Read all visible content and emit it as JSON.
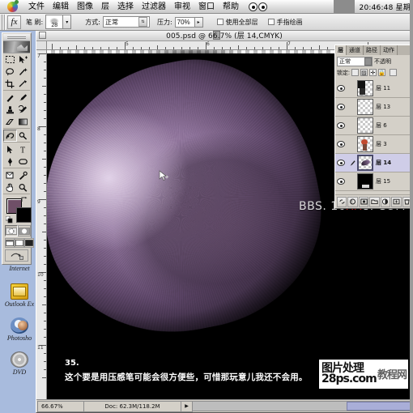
{
  "app": {
    "name": "Adobe Photoshop"
  },
  "menubar": {
    "apple_icon": "apple-logo",
    "items": [
      "文件",
      "编辑",
      "图像",
      "层",
      "选择",
      "过滤器",
      "审视",
      "窗口",
      "帮助"
    ],
    "clock": "20:46:48 星期"
  },
  "options_bar": {
    "tool_icon": "smudge-tool-icon",
    "brush_label": "笔 刷:",
    "brush_size": "28",
    "brush_dropdown_icon": "chevron-down-icon",
    "mode_label": "方式:",
    "mode_value": "正常",
    "mode_dropdown_icon": "updown-spinner-icon",
    "pressure_label": "压力:",
    "pressure_value": "70%",
    "pressure_dropdown_icon": "chevron-down-icon",
    "check_all_layers": "使用全部层",
    "check_finger_paint": "手指绘画"
  },
  "toolbox": {
    "tools": [
      {
        "name": "marquee-tool",
        "glyph": "▭"
      },
      {
        "name": "move-tool",
        "glyph": "✥"
      },
      {
        "name": "lasso-tool",
        "glyph": "◠"
      },
      {
        "name": "magic-wand-tool",
        "glyph": "✦"
      },
      {
        "name": "crop-tool",
        "glyph": "⌗"
      },
      {
        "name": "slice-tool",
        "glyph": "✂"
      },
      {
        "name": "healing-brush-tool",
        "glyph": "✒"
      },
      {
        "name": "paintbrush-tool",
        "glyph": "🖌"
      },
      {
        "name": "clone-stamp-tool",
        "glyph": "❏"
      },
      {
        "name": "history-brush-tool",
        "glyph": "↺"
      },
      {
        "name": "eraser-tool",
        "glyph": "◫"
      },
      {
        "name": "gradient-tool",
        "glyph": "▰"
      },
      {
        "name": "blur-smudge-tool",
        "glyph": "☁"
      },
      {
        "name": "dodge-burn-tool",
        "glyph": "✋"
      },
      {
        "name": "path-selection-tool",
        "glyph": "➤"
      },
      {
        "name": "type-tool",
        "glyph": "T"
      },
      {
        "name": "pen-tool",
        "glyph": "✎"
      },
      {
        "name": "shape-tool",
        "glyph": "▢"
      },
      {
        "name": "notes-tool",
        "glyph": "▤"
      },
      {
        "name": "eyedropper-tool",
        "glyph": "⚲"
      },
      {
        "name": "hand-tool",
        "glyph": "✋"
      },
      {
        "name": "zoom-tool",
        "glyph": "🔍"
      }
    ],
    "selected_tool": "blur-smudge-tool",
    "foreground_color": "#6f4f67",
    "background_color": "#000000",
    "mask_modes": [
      "standard-mask-mode",
      "quick-mask-mode"
    ],
    "screen_modes": [
      "standard-screen-mode",
      "full-screen-with-menubar",
      "full-screen-mode"
    ],
    "jump_to": "jump-to-imageready"
  },
  "document": {
    "title": "005.psd @ 66.7% (层 14,CMYK)",
    "close_icon": "close-box-icon",
    "ruler_h_numbers": [
      "5",
      "6",
      "7"
    ],
    "ruler_v_numbers": [
      "7",
      "8",
      "9",
      "10",
      "11"
    ],
    "canvas_watermark": {
      "line1": "PS",
      "line2_pre": "BBS. 16",
      "line2_red": "XX",
      "line2_post": "8. COM"
    },
    "cursor_icon": "brush-cursor-icon"
  },
  "caption": {
    "number": "35.",
    "text": "这个要是用压感笔可能会很方便些，可惜那玩意儿我还不会用。"
  },
  "watermark_box": {
    "line1": "图片处理",
    "line2": "28ps.com",
    "diagonal": "教程网"
  },
  "status_bar": {
    "zoom": "66.67%",
    "doc_info": "Doc: 62.3M/118.2M",
    "menu_icon": "triangle-right-icon"
  },
  "layers_palette": {
    "tabs": [
      {
        "label": "层",
        "active": true
      },
      {
        "label": "通道",
        "active": false
      },
      {
        "label": "路径",
        "active": false
      },
      {
        "label": "动作",
        "active": false
      }
    ],
    "blend_mode": "正常",
    "opacity_label": "不透明",
    "lock_label": "锁定:",
    "lock_icons": [
      "lock-transparent-icon",
      "lock-image-icon",
      "lock-position-icon",
      "lock-all-icon"
    ],
    "layers": [
      {
        "name": "层 11",
        "visible": true,
        "selected": false,
        "thumb": "partial-black-shape"
      },
      {
        "name": "层 13",
        "visible": true,
        "selected": false,
        "thumb": "empty"
      },
      {
        "name": "层 6",
        "visible": true,
        "selected": false,
        "thumb": "empty"
      },
      {
        "name": "层 3",
        "visible": true,
        "selected": false,
        "thumb": "small-red-shape"
      },
      {
        "name": "层 14",
        "visible": true,
        "selected": true,
        "thumb": "purple-fur-shape"
      },
      {
        "name": "层 15",
        "visible": true,
        "selected": false,
        "thumb": "black-fill"
      }
    ],
    "bottom_buttons": [
      "link-layers-icon",
      "add-layer-style-icon",
      "add-mask-icon",
      "new-group-icon",
      "new-adjustment-layer-icon",
      "new-layer-icon",
      "delete-layer-icon"
    ]
  },
  "desktop_icons": [
    {
      "label": "Internet",
      "icon": "internet-explorer-icon"
    },
    {
      "label": "Outlook Ex",
      "icon": "outlook-express-icon"
    },
    {
      "label": "Photosho",
      "icon": "photoshop-icon"
    },
    {
      "label": "DVD",
      "icon": "dvd-drive-icon"
    }
  ]
}
